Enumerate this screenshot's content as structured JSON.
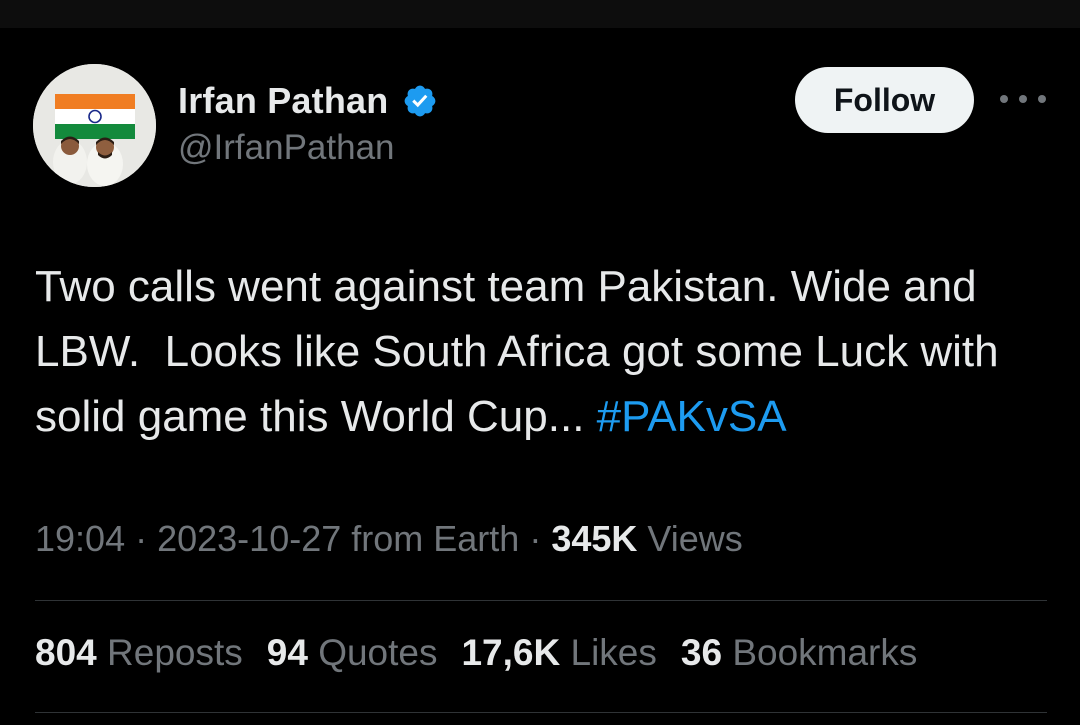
{
  "tweet": {
    "author": {
      "display_name": "Irfan Pathan",
      "handle": "@IrfanPathan",
      "verified": true,
      "avatar_icon": "profile-photo-with-indian-flag"
    },
    "actions": {
      "follow_label": "Follow",
      "more_icon": "more-dots-icon"
    },
    "text_main": "Two calls went against team Pakistan. Wide and LBW.  Looks like South Africa got some Luck with solid game this World Cup... ",
    "hashtag": "#PAKvSA",
    "meta": {
      "time": "19:04",
      "sep1": " · ",
      "date": "2023-10-27",
      "source": " from Earth",
      "sep2": " · ",
      "views_count": "345K",
      "views_label": " Views"
    },
    "stats": [
      {
        "count": "804",
        "label": "Reposts"
      },
      {
        "count": "94",
        "label": "Quotes"
      },
      {
        "count": "17,6K",
        "label": "Likes"
      },
      {
        "count": "36",
        "label": "Bookmarks"
      }
    ]
  },
  "colors": {
    "background": "#000000",
    "text": "#e7e9ea",
    "secondary": "#71767b",
    "accent": "#1d9bf0",
    "divider": "#2f3336"
  }
}
